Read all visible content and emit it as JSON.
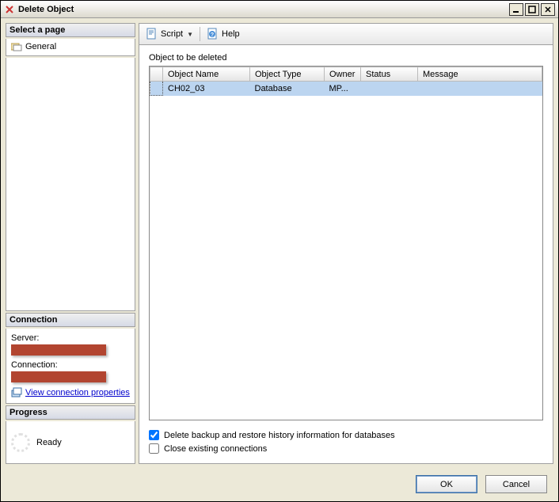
{
  "window": {
    "title": "Delete Object"
  },
  "sidebar": {
    "select_page_header": "Select a page",
    "pages": [
      {
        "label": "General"
      }
    ],
    "connection_header": "Connection",
    "server_label": "Server:",
    "connection_label": "Connection:",
    "view_properties_link": "View connection properties",
    "progress_header": "Progress",
    "progress_status": "Ready"
  },
  "toolbar": {
    "script_label": "Script",
    "help_label": "Help"
  },
  "main": {
    "caption": "Object to be deleted",
    "columns": {
      "name": "Object Name",
      "type": "Object Type",
      "owner": "Owner",
      "status": "Status",
      "message": "Message"
    },
    "rows": [
      {
        "name": "CH02_03",
        "type": "Database",
        "owner": "MP...",
        "status": "",
        "message": ""
      }
    ]
  },
  "options": {
    "delete_backup": {
      "label": "Delete backup and restore history information for databases",
      "checked": true
    },
    "close_conn": {
      "label": "Close existing connections",
      "checked": false
    }
  },
  "buttons": {
    "ok": "OK",
    "cancel": "Cancel"
  }
}
